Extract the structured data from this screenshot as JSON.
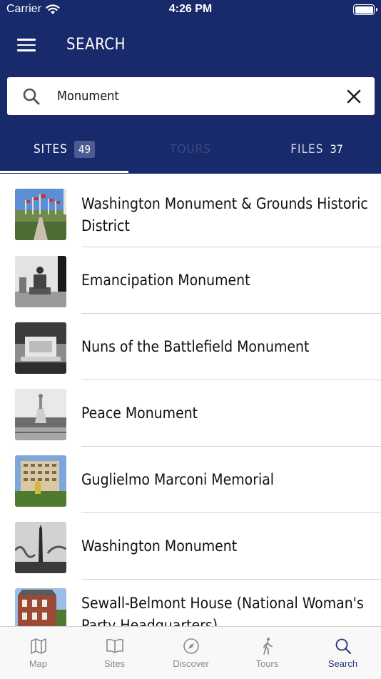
{
  "status_bar": {
    "carrier": "Carrier",
    "time": "4:26 PM"
  },
  "header": {
    "title": "SEARCH"
  },
  "search": {
    "value": "Monument",
    "placeholder": ""
  },
  "tabs": [
    {
      "label": "SITES",
      "count": "49",
      "active": true
    },
    {
      "label": "TOURS",
      "count": "",
      "active": false
    },
    {
      "label": "FILES",
      "count": "37",
      "active": false
    }
  ],
  "results": [
    {
      "title": "Washington Monument & Grounds Historic District",
      "thumb": "color-flags"
    },
    {
      "title": "Emancipation Monument",
      "thumb": "bw-statue"
    },
    {
      "title": "Nuns of the Battlefield Monument",
      "thumb": "bw-memorial"
    },
    {
      "title": "Peace Monument",
      "thumb": "bw-peace"
    },
    {
      "title": "Guglielmo Marconi Memorial",
      "thumb": "color-building"
    },
    {
      "title": "Washington Monument",
      "thumb": "bw-obelisk"
    },
    {
      "title": "Sewall-Belmont House (National Woman's Party Headquarters)",
      "thumb": "color-brick"
    }
  ],
  "tab_bar": [
    {
      "label": "Map",
      "icon": "map-icon",
      "active": false
    },
    {
      "label": "Sites",
      "icon": "book-icon",
      "active": false
    },
    {
      "label": "Discover",
      "icon": "compass-icon",
      "active": false
    },
    {
      "label": "Tours",
      "icon": "walking-icon",
      "active": false
    },
    {
      "label": "Search",
      "icon": "search-icon",
      "active": true
    }
  ],
  "colors": {
    "header_bg": "#182a6b",
    "active_tab": "#22357a",
    "badge_bg": "#4c5c93"
  }
}
